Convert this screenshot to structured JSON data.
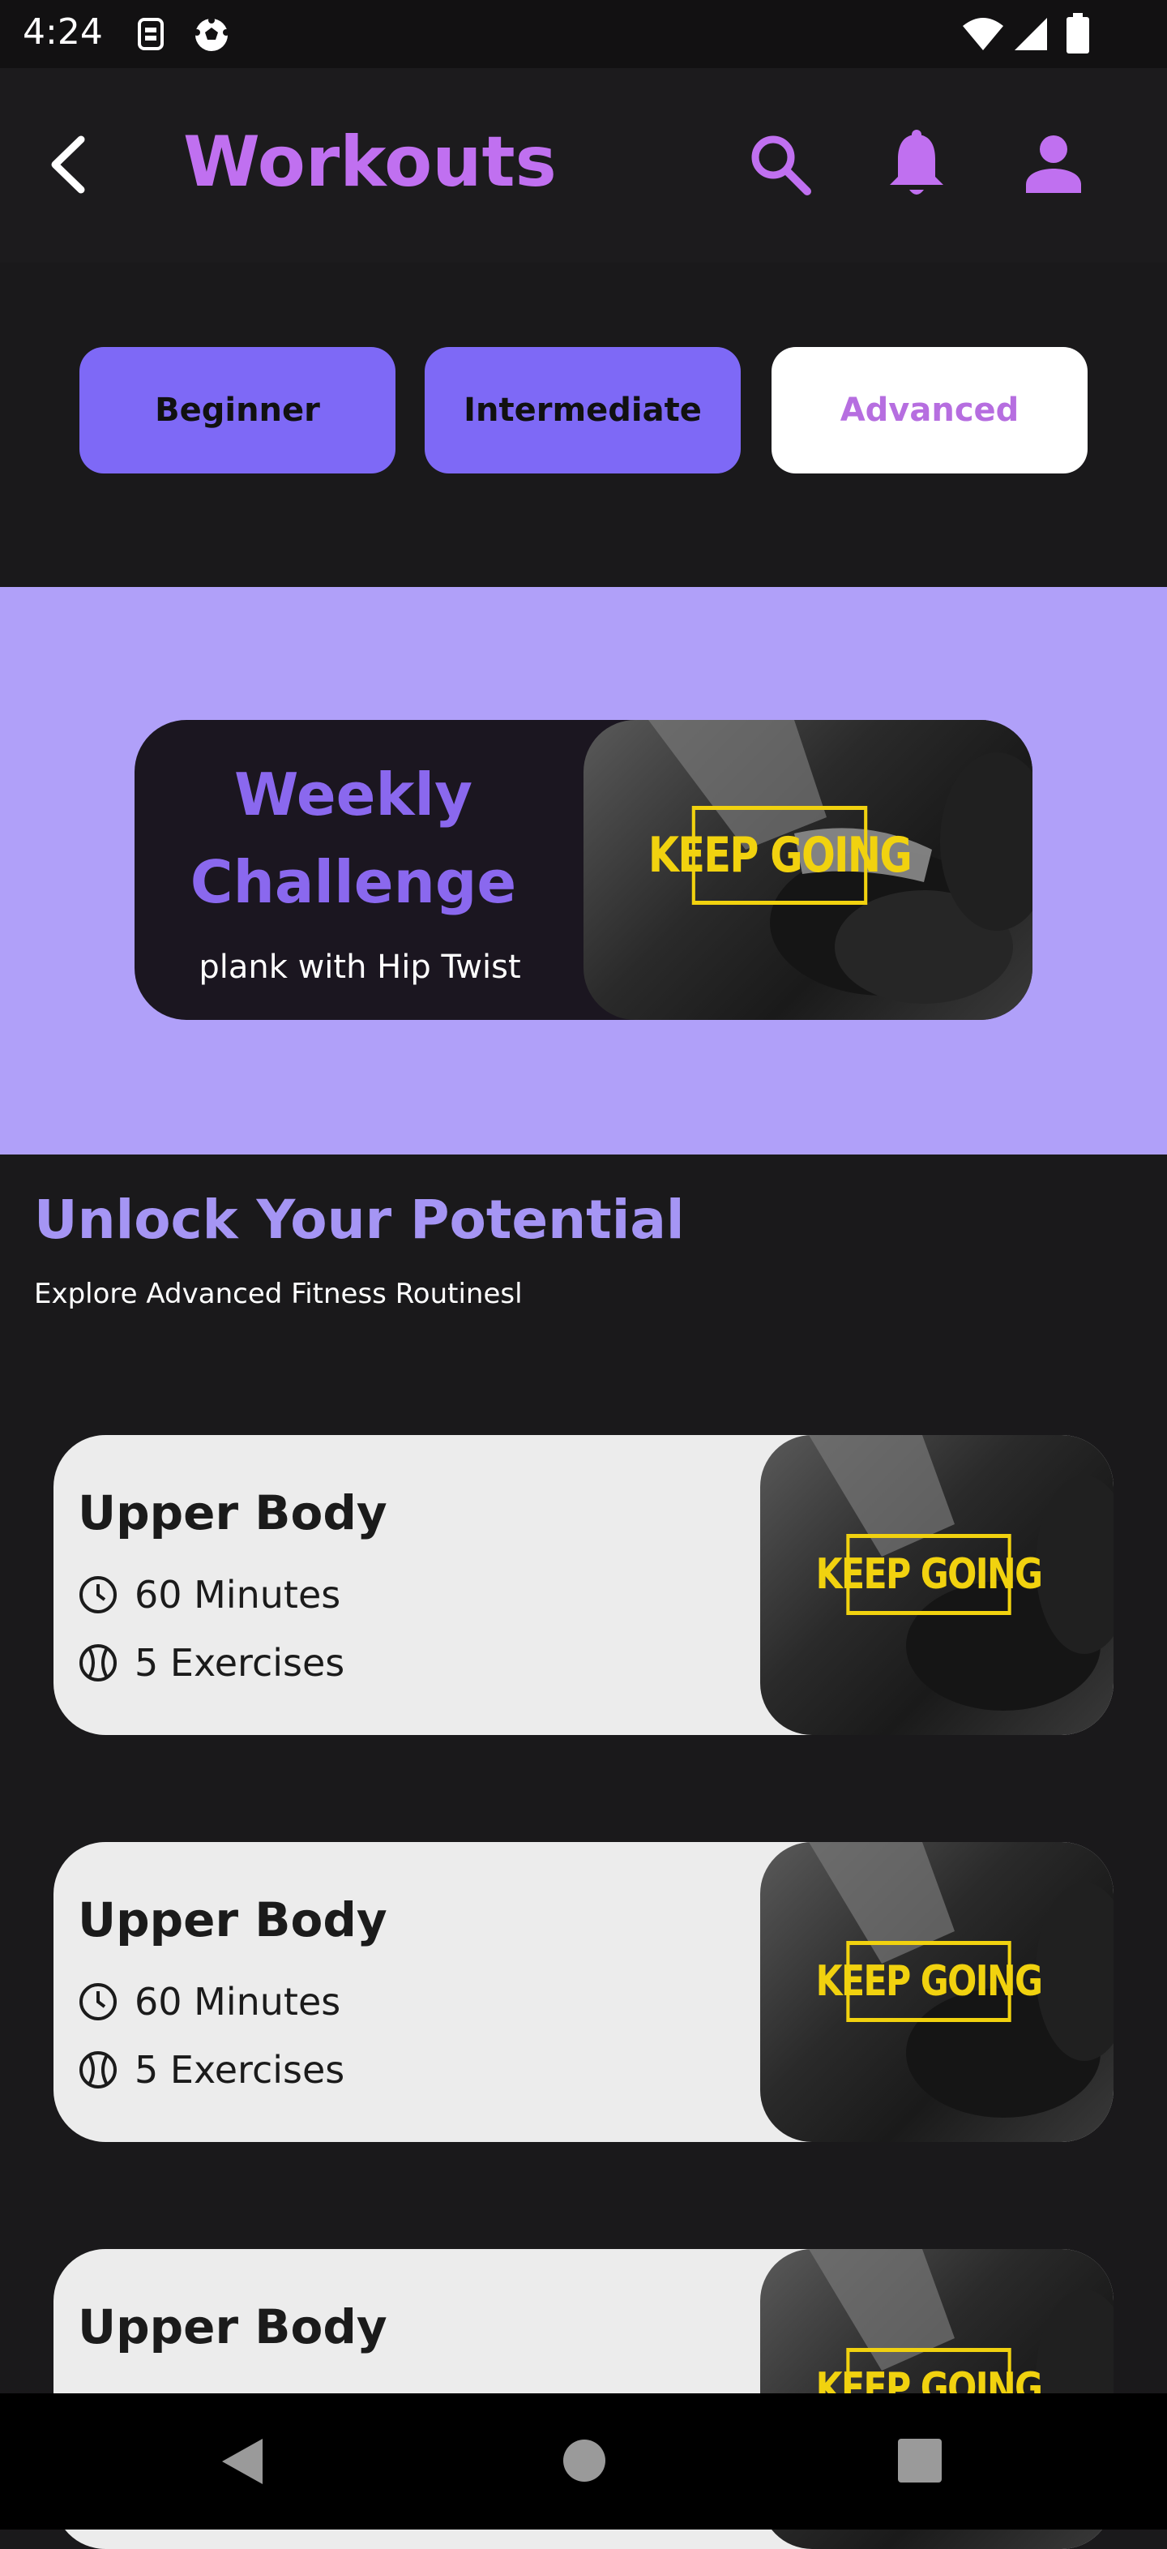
{
  "status_bar": {
    "time": "4:24",
    "left_icons": [
      "sim-icon",
      "soccer-ball-icon"
    ],
    "right_icons": [
      "wifi-icon",
      "cell-signal-icon",
      "battery-icon"
    ]
  },
  "app_bar": {
    "title": "Workouts",
    "icons": [
      "back-arrow-icon",
      "search-icon",
      "bell-icon",
      "person-icon"
    ]
  },
  "levels": [
    {
      "label": "Beginner",
      "selected": false
    },
    {
      "label": "Intermediate",
      "selected": false
    },
    {
      "label": "Advanced",
      "selected": true
    }
  ],
  "challenge": {
    "title_line1": "Weekly",
    "title_line2": "Challenge",
    "subtitle": "plank with Hip Twist",
    "image_text": "KEEP GOING"
  },
  "section": {
    "title": "Unlock Your Potential",
    "subtitle": "Explore Advanced Fitness Routinesl"
  },
  "workouts": [
    {
      "title": "Upper Body",
      "duration": "60 Minutes",
      "exercises": "5 Exercises",
      "image_text": "KEEP GOING"
    },
    {
      "title": "Upper Body",
      "duration": "60 Minutes",
      "exercises": "5 Exercises",
      "image_text": "KEEP GOING"
    },
    {
      "title": "Upper Body",
      "duration": "",
      "exercises": "",
      "image_text": "KEEP GOING"
    }
  ],
  "colors": {
    "background": "#1a191b",
    "accent_purple": "#c070f0",
    "chip_purple": "#7e69f6",
    "banner_lavender": "#b0a0f9",
    "heading_lavender": "#a595f4",
    "keep_going_yellow": "#f1d20f"
  },
  "nav_bar": {
    "icons": [
      "back-triangle-icon",
      "home-circle-icon",
      "recents-square-icon"
    ]
  }
}
